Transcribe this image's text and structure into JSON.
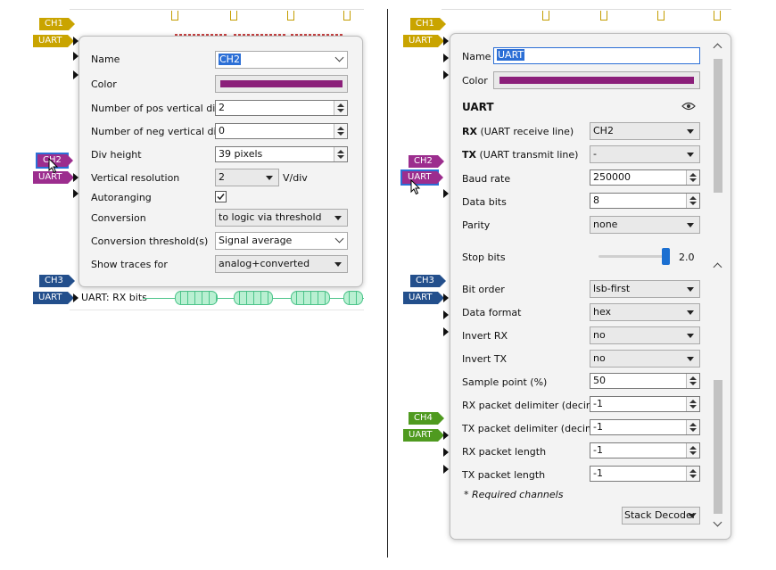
{
  "left": {
    "channels": [
      "CH1",
      "UART",
      "CH2",
      "UART",
      "CH3",
      "UART"
    ],
    "decoder_label": "UART: RX bits",
    "popup": {
      "name_label": "Name",
      "name_value": "CH2",
      "color_label": "Color",
      "color_value": "#8b1f7a",
      "pos_divs_label": "Number of pos vertical divs",
      "pos_divs_value": "2",
      "neg_divs_label": "Number of neg vertical divs",
      "neg_divs_value": "0",
      "div_height_label": "Div height",
      "div_height_value": "39 pixels",
      "vres_label": "Vertical resolution",
      "vres_value": "2",
      "vres_unit": "V/div",
      "autorange_label": "Autoranging",
      "autorange_checked": true,
      "conversion_label": "Conversion",
      "conversion_value": "to logic via threshold",
      "threshold_label": "Conversion threshold(s)",
      "threshold_value": "Signal average",
      "show_traces_label": "Show traces for",
      "show_traces_value": "analog+converted"
    }
  },
  "right": {
    "channels": [
      "CH1",
      "UART",
      "CH2",
      "UART",
      "CH3",
      "UART",
      "CH4",
      "UART"
    ],
    "popup": {
      "name_label": "Name",
      "name_value": "UART",
      "color_label": "Color",
      "color_value": "#8b1f7a",
      "section_title": "UART",
      "rx_label_bold": "RX",
      "rx_label_rest": " (UART receive line)",
      "rx_value": "CH2",
      "tx_label_bold": "TX",
      "tx_label_rest": " (UART transmit line)",
      "tx_value": "-",
      "baud_label": "Baud rate",
      "baud_value": "250000",
      "databits_label": "Data bits",
      "databits_value": "8",
      "parity_label": "Parity",
      "parity_value": "none",
      "stopbits_label": "Stop bits",
      "stopbits_value": "2.0",
      "stopbits_level": 1.0,
      "bitorder_label": "Bit order",
      "bitorder_value": "lsb-first",
      "dataformat_label": "Data format",
      "dataformat_value": "hex",
      "invertrx_label": "Invert RX",
      "invertrx_value": "no",
      "inverttx_label": "Invert TX",
      "inverttx_value": "no",
      "sample_label": "Sample point (%)",
      "sample_value": "50",
      "rxdelim_label": "RX packet delimiter (decimal)",
      "rxdelim_value": "-1",
      "txdelim_label": "TX packet delimiter (decimal)",
      "txdelim_value": "-1",
      "rxlen_label": "RX packet length",
      "rxlen_value": "-1",
      "txlen_label": "TX packet length",
      "txlen_value": "-1",
      "required_note": "* Required channels",
      "stack_button": "Stack Decoder"
    }
  },
  "colors": {
    "ch1": "#c9a400",
    "ch2": "#9c2d8e",
    "ch3": "#234f8c",
    "ch4": "#4f9a1f",
    "accent_select": "#2c6fd6",
    "decoder_green": "#4cc48a"
  }
}
